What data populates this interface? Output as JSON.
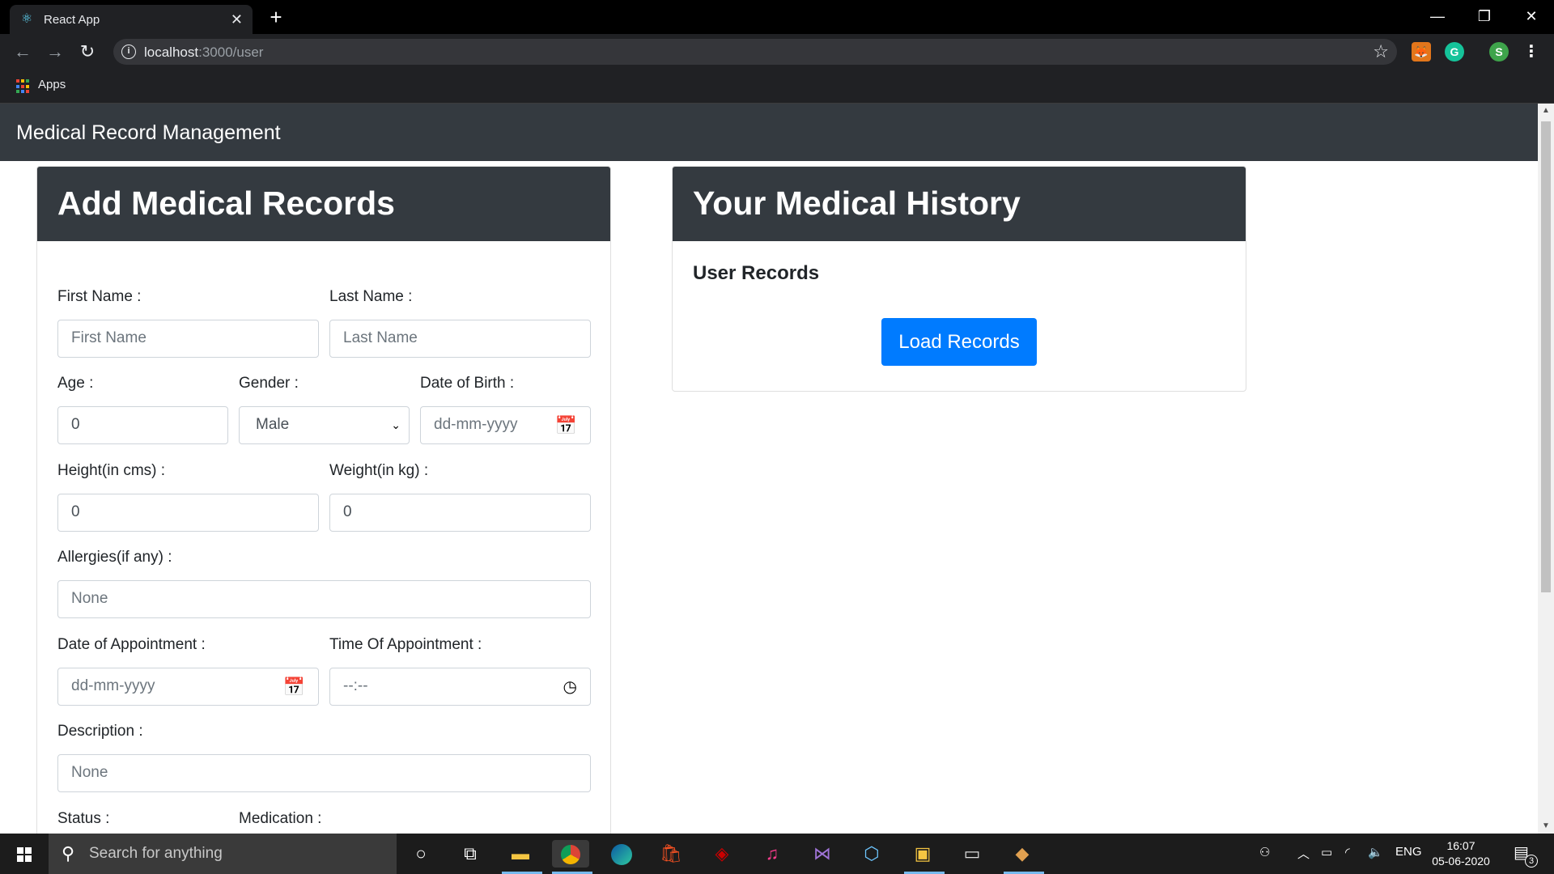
{
  "browser": {
    "tab_title": "React App",
    "url_host": "localhost",
    "url_rest": ":3000/user",
    "bookmarks_apps_label": "Apps",
    "profile_initial": "S",
    "grammarly_initial": "G"
  },
  "app": {
    "brand": "Medical Record Management"
  },
  "add_card": {
    "title": "Add Medical Records",
    "fields": {
      "first_name": {
        "label": "First Name :",
        "placeholder": "First Name"
      },
      "last_name": {
        "label": "Last Name :",
        "placeholder": "Last Name"
      },
      "age": {
        "label": "Age :",
        "value": "0"
      },
      "gender": {
        "label": "Gender :",
        "value": "Male"
      },
      "dob": {
        "label": "Date of Birth :",
        "placeholder": "dd-mm-yyyy"
      },
      "height": {
        "label": "Height(in cms) :",
        "value": "0"
      },
      "weight": {
        "label": "Weight(in kg) :",
        "value": "0"
      },
      "allergies": {
        "label": "Allergies(if any) :",
        "placeholder": "None"
      },
      "appointment_date": {
        "label": "Date of Appointment :",
        "placeholder": "dd-mm-yyyy"
      },
      "appointment_time": {
        "label": "Time Of Appointment :",
        "placeholder": "--:--"
      },
      "description": {
        "label": "Description :",
        "placeholder": "None"
      },
      "status": {
        "label": "Status :"
      },
      "medication": {
        "label": "Medication :"
      }
    }
  },
  "history_card": {
    "title": "Your Medical History",
    "subtitle": "User Records",
    "load_button": "Load Records"
  },
  "taskbar": {
    "search_placeholder": "Search for anything",
    "lang": "ENG",
    "time": "16:07",
    "date": "05-06-2020",
    "notifications": "3"
  },
  "colors": {
    "navbar": "#343a40",
    "primary": "#007bff",
    "chrome_dark": "#202124"
  }
}
